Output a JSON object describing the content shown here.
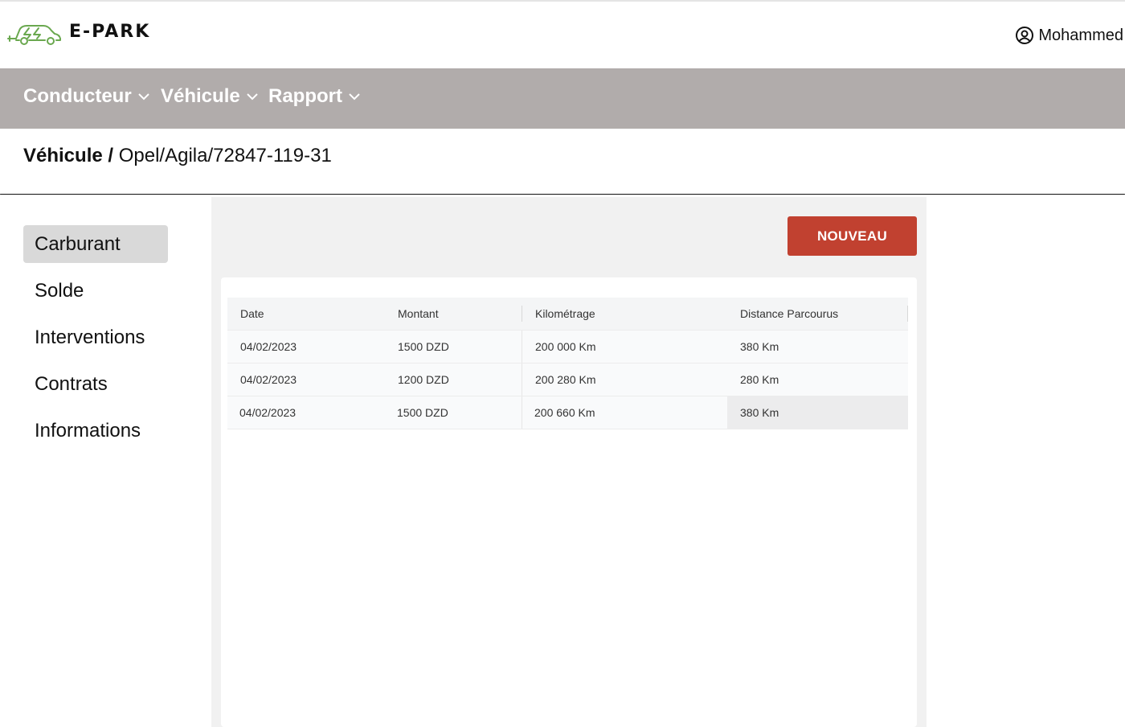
{
  "header": {
    "logo_text": "E-PARK",
    "user_name": "Mohammed"
  },
  "nav": {
    "items": [
      {
        "label": "Conducteur"
      },
      {
        "label": "Véhicule"
      },
      {
        "label": "Rapport"
      }
    ]
  },
  "breadcrumb": {
    "root": "Véhicule",
    "separator": " / ",
    "current": "Opel/Agila/72847-119-31"
  },
  "sidebar": {
    "items": [
      {
        "label": "Carburant",
        "active": true
      },
      {
        "label": "Solde"
      },
      {
        "label": "Interventions"
      },
      {
        "label": "Contrats"
      },
      {
        "label": "Informations"
      }
    ]
  },
  "actions": {
    "new_label": "NOUVEAU"
  },
  "table": {
    "columns": [
      "Date",
      "Montant",
      "Kilométrage",
      "Distance Parcourus"
    ],
    "rows": [
      [
        "04/02/2023",
        "1500 DZD",
        "200 000 Km",
        "380 Km"
      ],
      [
        "04/02/2023",
        "1200 DZD",
        "200 280 Km",
        "280 Km"
      ],
      [
        "04/02/2023",
        "1500 DZD",
        "200 660 Km",
        "380 Km"
      ]
    ]
  },
  "colors": {
    "navbar": "#b1acab",
    "accent_button": "#c14130",
    "logo_green": "#6aa84f",
    "active_side": "#d9d9d9",
    "main_bg": "#f1f1f1"
  }
}
